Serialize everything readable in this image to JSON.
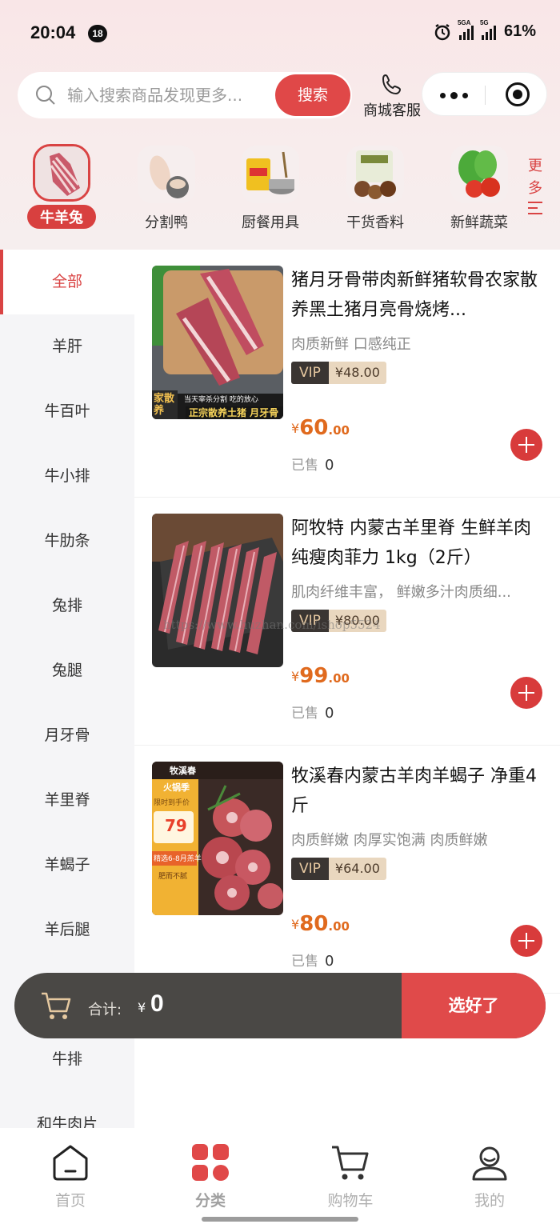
{
  "status_bar": {
    "time": "20:04",
    "badge": "18",
    "net1": "5GA",
    "net2": "5G",
    "battery": "61%"
  },
  "search": {
    "placeholder": "输入搜索商品发现更多...",
    "button": "搜索"
  },
  "service": {
    "label": "商城客服",
    "icon": "phone-icon"
  },
  "categories": [
    {
      "label": "牛羊兔",
      "active": true
    },
    {
      "label": "分割鸭"
    },
    {
      "label": "厨餐用具"
    },
    {
      "label": "干货香料"
    },
    {
      "label": "新鲜蔬菜"
    }
  ],
  "more": {
    "line1": "更",
    "line2": "多"
  },
  "sidebar": [
    "全部",
    "羊肝",
    "牛百叶",
    "牛小排",
    "牛肋条",
    "兔排",
    "兔腿",
    "月牙骨",
    "羊里脊",
    "羊蝎子",
    "羊后腿",
    "",
    "牛排",
    "和牛肉片"
  ],
  "products": [
    {
      "title": "猪月牙骨带肉新鲜猪软骨农家散养黑土猪月亮骨烧烤...",
      "desc": "肉质新鲜 口感纯正",
      "vip_label": "VIP",
      "vip_price": "¥48.00",
      "price_currency": "¥",
      "price_int": "60",
      "price_dec": ".00",
      "sold_label": "已售",
      "sold": "0",
      "banner_left": "家散养",
      "banner_top": "当天宰杀分割 吃的放心",
      "banner_right": "正宗散养土猪 月牙骨"
    },
    {
      "title": "阿牧特 内蒙古羊里脊 生鲜羊肉纯瘦肉菲力 1kg（2斤）",
      "desc": "肌肉纤维丰富， 鲜嫩多汁肉质细...",
      "vip_label": "VIP",
      "vip_price": "¥80.00",
      "price_currency": "¥",
      "price_int": "99",
      "price_dec": ".00",
      "sold_label": "已售",
      "sold": "0",
      "watermark": "https://www.huzhan.com/ishop5524"
    },
    {
      "title": "牧溪春内蒙古羊肉羊蝎子 净重4斤",
      "desc": "肉质鲜嫩 肉厚实饱满 肉质鲜嫩",
      "vip_label": "VIP",
      "vip_price": "¥64.00",
      "price_currency": "¥",
      "price_int": "80",
      "price_dec": ".00",
      "sold_label": "已售",
      "sold": "0",
      "img_brand": "牧溪春",
      "img_tag": "火锅季",
      "img_price_label": "限时到手价",
      "img_price": "79",
      "img_line1": "精选6-8月羔羊",
      "img_line2": "肥而不腻"
    }
  ],
  "cart": {
    "total_label": "合计:",
    "currency": "¥",
    "amount": "0",
    "checkout": "选好了"
  },
  "nav": [
    {
      "label": "首页",
      "icon": "home-icon"
    },
    {
      "label": "分类",
      "icon": "category-icon",
      "active": true
    },
    {
      "label": "购物车",
      "icon": "cart-icon"
    },
    {
      "label": "我的",
      "icon": "user-icon"
    }
  ],
  "colors": {
    "accent": "#d94343",
    "price": "#e06a1e",
    "vip_dark": "#3a3532",
    "vip_light": "#e9d7bf"
  }
}
